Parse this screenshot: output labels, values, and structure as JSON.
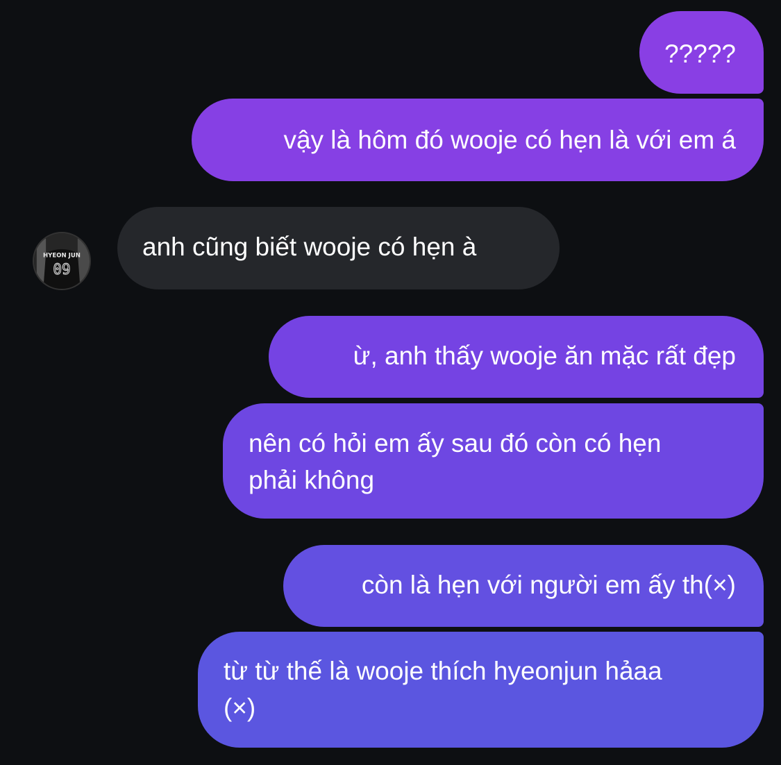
{
  "conversation": {
    "messages": [
      {
        "side": "sent",
        "lines": [
          "?????"
        ]
      },
      {
        "side": "sent",
        "lines": [
          "vậy là hôm đó wooje có hẹn là với em á"
        ]
      },
      {
        "side": "received",
        "lines": [
          "anh cũng biết wooje có hẹn à"
        ]
      },
      {
        "side": "sent",
        "lines": [
          "ừ, anh thấy wooje ăn mặc rất đẹp"
        ]
      },
      {
        "side": "sent",
        "lines": [
          "nên có hỏi em ấy sau đó còn có hẹn",
          "phải không"
        ]
      },
      {
        "side": "sent",
        "lines": [
          "còn là hẹn với người em ấy th(×)"
        ]
      },
      {
        "side": "sent",
        "lines": [
          "từ từ thế là wooje thích hyeonjun hảaa",
          "(×)"
        ]
      }
    ]
  },
  "avatar": {
    "jersey_name": "HYEON JUN",
    "jersey_number": "09"
  },
  "colors": {
    "background": "#0d0f12",
    "received_bubble": "#25272b",
    "sent_gradient_top": "#8a3fe3",
    "sent_gradient_bottom": "#5a58e0"
  }
}
